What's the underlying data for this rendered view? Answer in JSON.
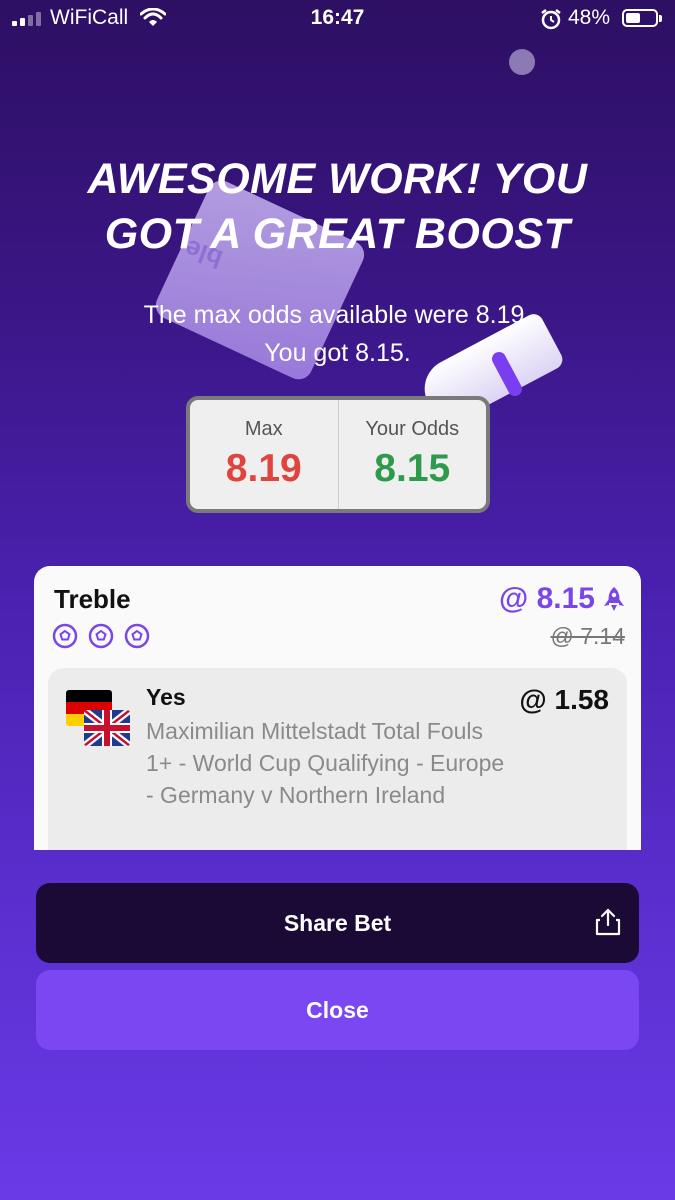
{
  "status_bar": {
    "carrier": "WiFiCall",
    "time": "16:47",
    "battery_percent": "48%",
    "battery_level": 0.48,
    "icons": [
      "signal-icon",
      "wifi-icon",
      "alarm-icon",
      "battery-icon"
    ]
  },
  "headline": {
    "line1": "AWESOME WORK! YOU",
    "line2": "GOT A GREAT BOOST"
  },
  "subtext": {
    "line1": "The max odds available were 8.19.",
    "line2": "You got 8.15."
  },
  "decoration": {
    "box_label": "ble"
  },
  "odds_panel": {
    "max_label": "Max",
    "max_value": "8.19",
    "yours_label": "Your Odds",
    "yours_value": "8.15"
  },
  "bet_card": {
    "title": "Treble",
    "leg_count": 3,
    "boosted_odds": "@ 8.15",
    "original_odds": "@ 7.14",
    "legs": [
      {
        "pick": "Yes",
        "odds": "@ 1.58",
        "description": "Maximilian Mittelstadt Total Fouls 1+ - World Cup Qualifying - Europe - Germany v Northern Ireland",
        "flags": [
          "germany-flag",
          "uk-flag"
        ]
      }
    ]
  },
  "buttons": {
    "share_label": "Share Bet",
    "close_label": "Close"
  },
  "colors": {
    "accent": "#7a47f2",
    "max_odds": "#e0443f",
    "your_odds": "#2e9a4b",
    "boosted_odds": "#7a46e8",
    "share_button": "#1a0a35"
  }
}
